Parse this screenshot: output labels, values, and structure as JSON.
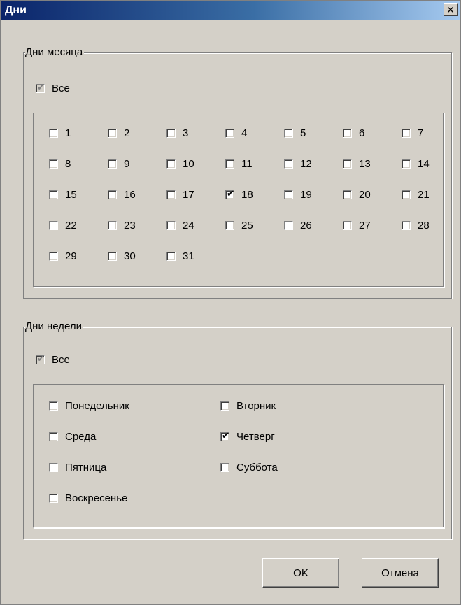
{
  "window": {
    "title": "Дни",
    "close_glyph": "✕"
  },
  "month_group": {
    "label": "Дни месяца",
    "all_label": "Все",
    "all_checked": true,
    "days": [
      {
        "label": "1",
        "checked": false
      },
      {
        "label": "2",
        "checked": false
      },
      {
        "label": "3",
        "checked": false
      },
      {
        "label": "4",
        "checked": false
      },
      {
        "label": "5",
        "checked": false
      },
      {
        "label": "6",
        "checked": false
      },
      {
        "label": "7",
        "checked": false
      },
      {
        "label": "8",
        "checked": false
      },
      {
        "label": "9",
        "checked": false
      },
      {
        "label": "10",
        "checked": false
      },
      {
        "label": "11",
        "checked": false
      },
      {
        "label": "12",
        "checked": false
      },
      {
        "label": "13",
        "checked": false
      },
      {
        "label": "14",
        "checked": false
      },
      {
        "label": "15",
        "checked": false
      },
      {
        "label": "16",
        "checked": false
      },
      {
        "label": "17",
        "checked": false
      },
      {
        "label": "18",
        "checked": true
      },
      {
        "label": "19",
        "checked": false
      },
      {
        "label": "20",
        "checked": false
      },
      {
        "label": "21",
        "checked": false
      },
      {
        "label": "22",
        "checked": false
      },
      {
        "label": "23",
        "checked": false
      },
      {
        "label": "24",
        "checked": false
      },
      {
        "label": "25",
        "checked": false
      },
      {
        "label": "26",
        "checked": false
      },
      {
        "label": "27",
        "checked": false
      },
      {
        "label": "28",
        "checked": false
      },
      {
        "label": "29",
        "checked": false
      },
      {
        "label": "30",
        "checked": false
      },
      {
        "label": "31",
        "checked": false
      }
    ]
  },
  "week_group": {
    "label": "Дни недели",
    "all_label": "Все",
    "all_checked": true,
    "days": [
      {
        "label": "Понедельник",
        "checked": false
      },
      {
        "label": "Вторник",
        "checked": false
      },
      {
        "label": "Среда",
        "checked": false
      },
      {
        "label": "Четверг",
        "checked": true
      },
      {
        "label": "Пятница",
        "checked": false
      },
      {
        "label": "Суббота",
        "checked": false
      },
      {
        "label": "Воскресенье",
        "checked": false
      }
    ]
  },
  "buttons": {
    "ok": "OK",
    "cancel": "Отмена"
  }
}
